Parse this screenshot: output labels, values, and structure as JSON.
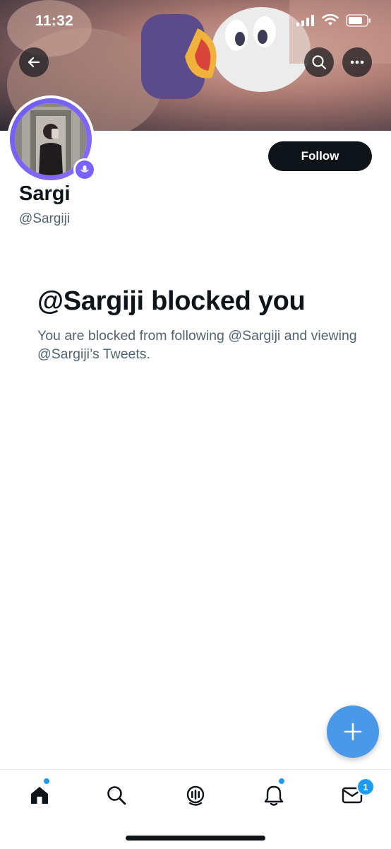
{
  "status_bar": {
    "time": "11:32"
  },
  "profile": {
    "display_name": "Sargi",
    "handle": "@Sargiji",
    "follow_label": "Follow"
  },
  "blocked": {
    "title": "@Sargiji blocked you",
    "description": "You are blocked from following @Sargiji and viewing @Sargiji’s Tweets."
  },
  "tabbar": {
    "items": [
      {
        "name": "home",
        "icon": "home-icon",
        "has_dot": true
      },
      {
        "name": "search",
        "icon": "search-icon",
        "has_dot": false
      },
      {
        "name": "spaces",
        "icon": "spaces-icon",
        "has_dot": false
      },
      {
        "name": "notifications",
        "icon": "bell-icon",
        "has_dot": true
      },
      {
        "name": "messages",
        "icon": "envelope-icon",
        "badge": "1"
      }
    ]
  },
  "colors": {
    "accent": "#1d9bf0",
    "fab": "#4a99e9",
    "avatar_ring": "#7b61ff",
    "text_primary": "#0f1419",
    "text_secondary": "#536471"
  }
}
